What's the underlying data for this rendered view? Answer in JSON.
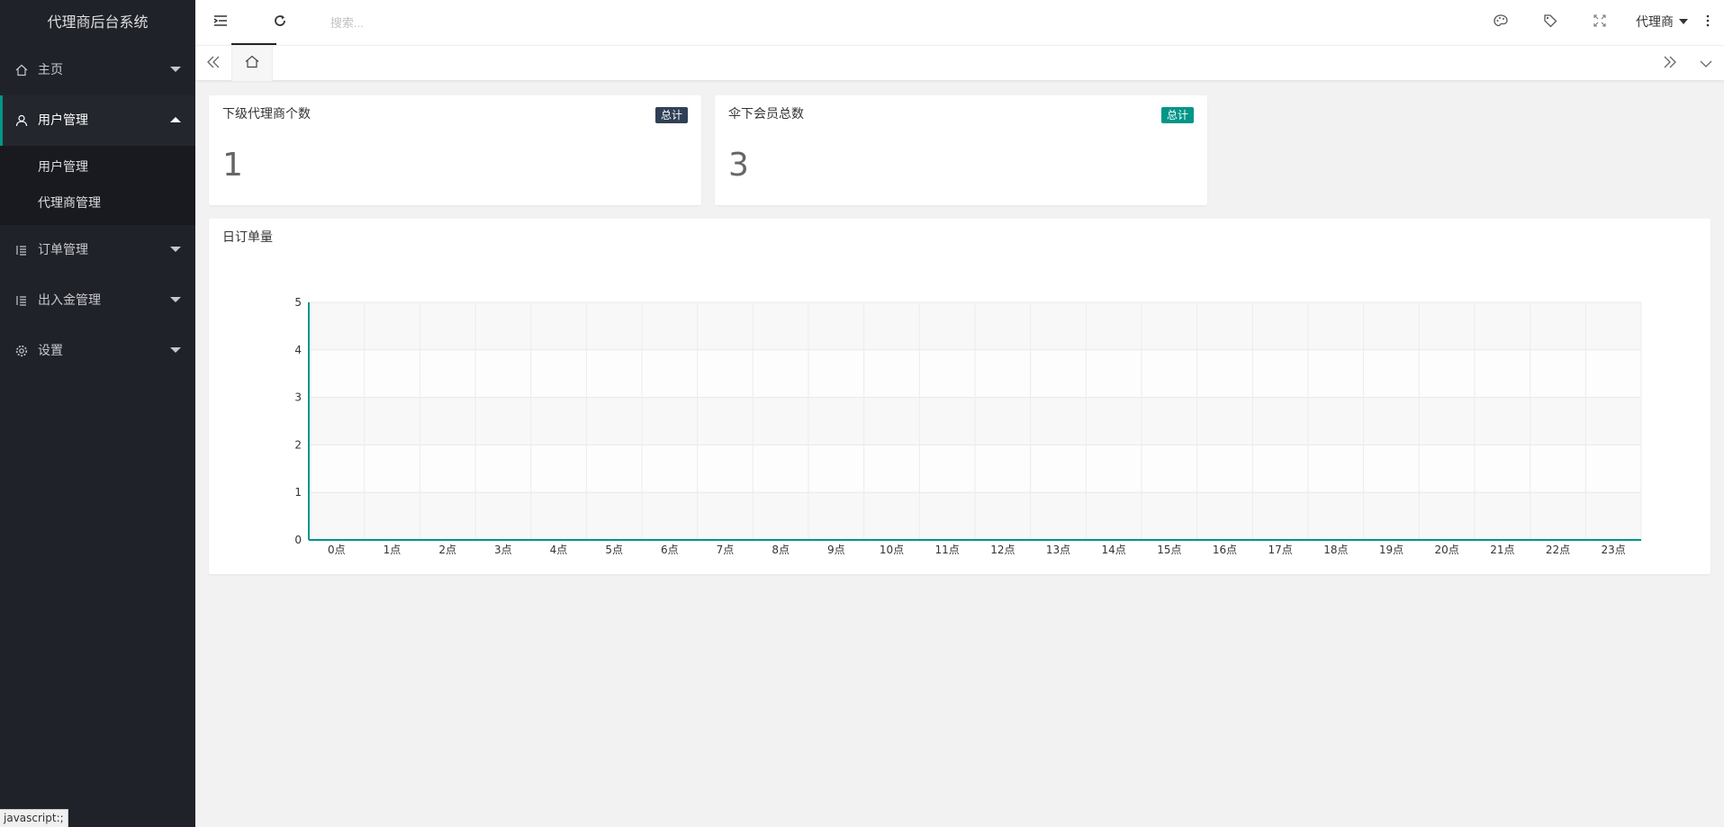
{
  "app": {
    "title": "代理商后台系统"
  },
  "sidebar": {
    "items": [
      {
        "label": "主页",
        "icon": "home-icon",
        "expanded": false
      },
      {
        "label": "用户管理",
        "icon": "user-icon",
        "expanded": true,
        "children": [
          {
            "label": "用户管理"
          },
          {
            "label": "代理商管理"
          }
        ]
      },
      {
        "label": "订单管理",
        "icon": "list-icon",
        "expanded": false
      },
      {
        "label": "出入金管理",
        "icon": "list-icon",
        "expanded": false
      },
      {
        "label": "设置",
        "icon": "gear-icon",
        "expanded": false
      }
    ]
  },
  "header": {
    "search_placeholder": "搜索...",
    "user_label": "代理商",
    "icons": [
      "menu-toggle-icon",
      "refresh-icon",
      "theme-icon",
      "tag-icon",
      "fullscreen-icon",
      "more-icon"
    ]
  },
  "tabs": {
    "icons": [
      "tabs-left-icon",
      "home-tab-icon",
      "tabs-right-icon",
      "tabs-dropdown-icon"
    ]
  },
  "stats": [
    {
      "title": "下级代理商个数",
      "badge": "总计",
      "value": "1",
      "badge_color": "#2f4056"
    },
    {
      "title": "伞下会员总数",
      "badge": "总计",
      "value": "3",
      "badge_color": "#009688"
    }
  ],
  "chart_data": {
    "type": "line",
    "title": "日订单量",
    "categories": [
      "0点",
      "1点",
      "2点",
      "3点",
      "4点",
      "5点",
      "6点",
      "7点",
      "8点",
      "9点",
      "10点",
      "11点",
      "12点",
      "13点",
      "14点",
      "15点",
      "16点",
      "17点",
      "18点",
      "19点",
      "20点",
      "21点",
      "22点",
      "23点"
    ],
    "series": [
      {
        "values": [
          0,
          0,
          0,
          0,
          0,
          0,
          0,
          0,
          0,
          0,
          0,
          0,
          0,
          0,
          0,
          0,
          0,
          0,
          0,
          0,
          0,
          0,
          0,
          0
        ]
      }
    ],
    "ylim": [
      0,
      5
    ],
    "yticks": [
      "0",
      "1",
      "2",
      "3",
      "4",
      "5"
    ],
    "grid": true,
    "line_color": "#009688"
  },
  "statusbar": {
    "text": "javascript:;"
  }
}
